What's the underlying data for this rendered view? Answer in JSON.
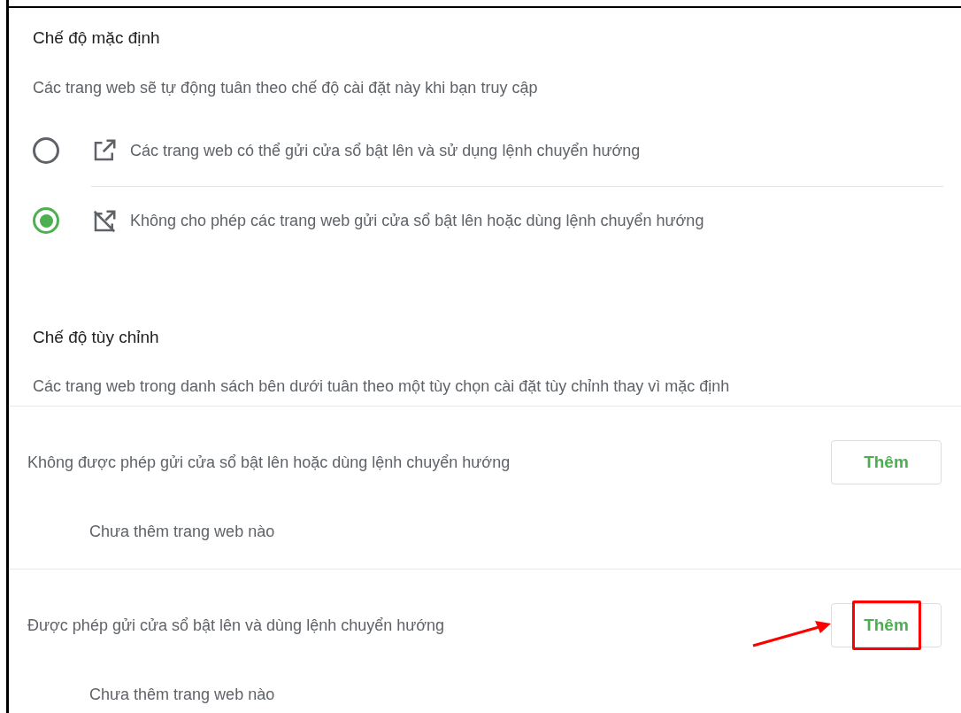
{
  "default_section": {
    "title": "Chế độ mặc định",
    "description": "Các trang web sẽ tự động tuân theo chế độ cài đặt này khi bạn truy cập",
    "options": [
      {
        "kind": "allow",
        "label": "Các trang web có thể gửi cửa sổ bật lên và sử dụng lệnh chuyển hướng",
        "selected": false
      },
      {
        "kind": "block",
        "label": "Không cho phép các trang web gửi cửa sổ bật lên hoặc dùng lệnh chuyển hướng",
        "selected": true
      }
    ]
  },
  "custom_section": {
    "title": "Chế độ tùy chỉnh",
    "description": "Các trang web trong danh sách bên dưới tuân theo một tùy chọn cài đặt tùy chỉnh thay vì mặc định",
    "lists": [
      {
        "label": "Không được phép gửi cửa sổ bật lên hoặc dùng lệnh chuyển hướng",
        "button": "Thêm",
        "empty_text": "Chưa thêm trang web nào",
        "highlighted": false
      },
      {
        "label": "Được phép gửi cửa sổ bật lên và dùng lệnh chuyển hướng",
        "button": "Thêm",
        "empty_text": "Chưa thêm trang web nào",
        "highlighted": true
      }
    ]
  }
}
